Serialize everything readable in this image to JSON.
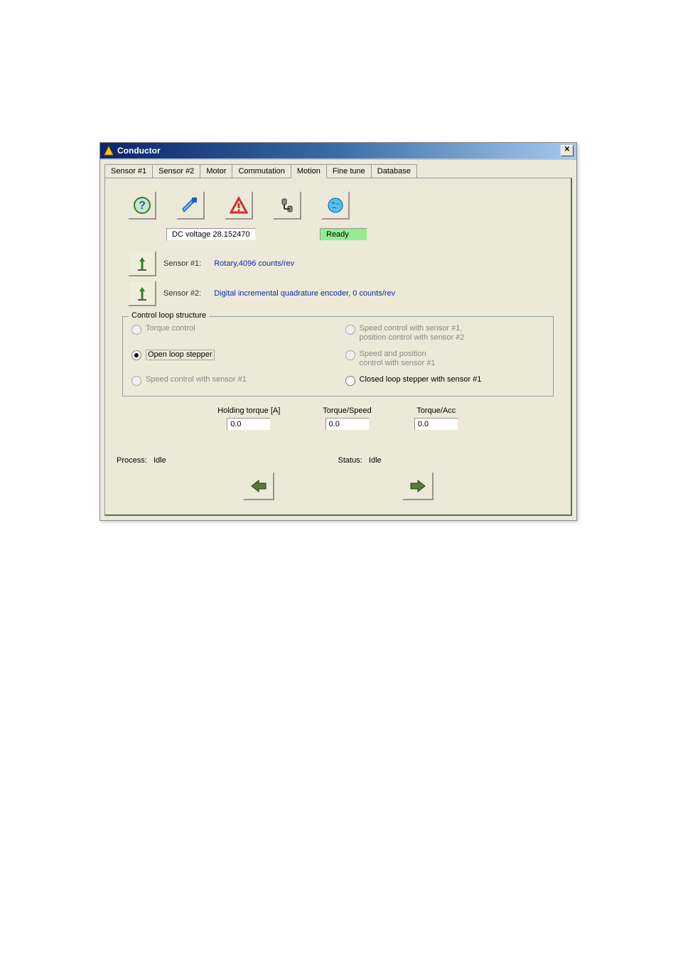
{
  "window": {
    "title": "Conductor"
  },
  "tabs": [
    "Sensor #1",
    "Sensor #2",
    "Motor",
    "Commutation",
    "Motion",
    "Fine tune",
    "Database"
  ],
  "active_tab": 4,
  "dc_voltage": "DC voltage 28.152470",
  "ready": "Ready",
  "sensor1": {
    "label": "Sensor #1:",
    "value": "Rotary,4096  counts/rev"
  },
  "sensor2": {
    "label": "Sensor #2:",
    "value": "Digital incremental quadrature encoder, 0 counts/rev"
  },
  "group": {
    "title": "Control loop structure",
    "options": [
      {
        "label": "Torque control",
        "checked": false,
        "disabled": true
      },
      {
        "label": "Speed control with sensor #1,\nposition control with sensor #2",
        "checked": false,
        "disabled": true
      },
      {
        "label": "Open loop stepper",
        "checked": true,
        "disabled": false
      },
      {
        "label": "Speed and position\ncontrol with sensor #1",
        "checked": false,
        "disabled": true
      },
      {
        "label": "Speed control with sensor #1",
        "checked": false,
        "disabled": true
      },
      {
        "label": "Closed loop stepper with sensor #1",
        "checked": false,
        "disabled": false
      }
    ]
  },
  "params": [
    {
      "label": "Holding torque [A]",
      "value": "0.0"
    },
    {
      "label": "Torque/Speed",
      "value": "0.0"
    },
    {
      "label": "Torque/Acc",
      "value": "0.0"
    }
  ],
  "process": {
    "label": "Process:",
    "value": "Idle"
  },
  "status": {
    "label": "Status:",
    "value": "Idle"
  }
}
